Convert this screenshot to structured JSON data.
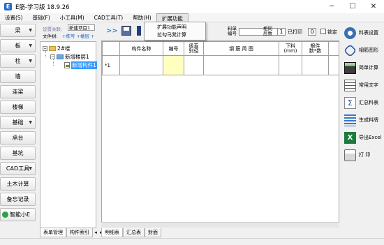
{
  "window": {
    "title": "E筋-学习版 18.9.26",
    "logo_letter": "E"
  },
  "menu": [
    "设置(S)",
    "基础(F)",
    "小工具(M)",
    "CAD工具(T)",
    "帮助(H)",
    "扩展功能"
  ],
  "dropdown": [
    "扩展功能声明",
    "拉勾马凳计算"
  ],
  "left_buttons": [
    "梁",
    "板",
    "柱",
    "墙",
    "连梁",
    "楼梯",
    "基础",
    "承台",
    "基坑",
    "CAD工具",
    "土木计算",
    "备忘记录",
    "智能小E"
  ],
  "tree": {
    "label_project": "设置关联:",
    "project_value": "新建项目1",
    "label_file": "文件树:",
    "file_options": "+栋号 +楼层 +",
    "root": "2#楼",
    "child": "新增楼层1",
    "leaf": "新增构件1"
  },
  "toolbar": {
    "expand": ">>",
    "lbl_code": "料单\n编号",
    "lbl_layers": "相同\n层数",
    "layers_value": "1",
    "lbl_printed": "已打印",
    "printed_value": "0",
    "lbl_lock": "锁定"
  },
  "grid": {
    "headers": [
      "构件名称",
      "编号",
      "级直\n别径",
      "钢 筋 简 图",
      "下料\n(mm)",
      "根件\n数*数",
      "根"
    ],
    "row_label": "*1"
  },
  "right_buttons": [
    "料表设置",
    "钢筋图形",
    "简单计算",
    "常用文字",
    "汇总料表",
    "生成料牌",
    "导出Excel",
    "打 印"
  ],
  "bottom_tabs_left": [
    "表单管理",
    "构件索引"
  ],
  "bottom_tabs_right": [
    "明细表",
    "汇总表",
    "封面"
  ],
  "colors": {
    "highlight_cell": "#ffffc0",
    "selection": "#3399ff"
  }
}
